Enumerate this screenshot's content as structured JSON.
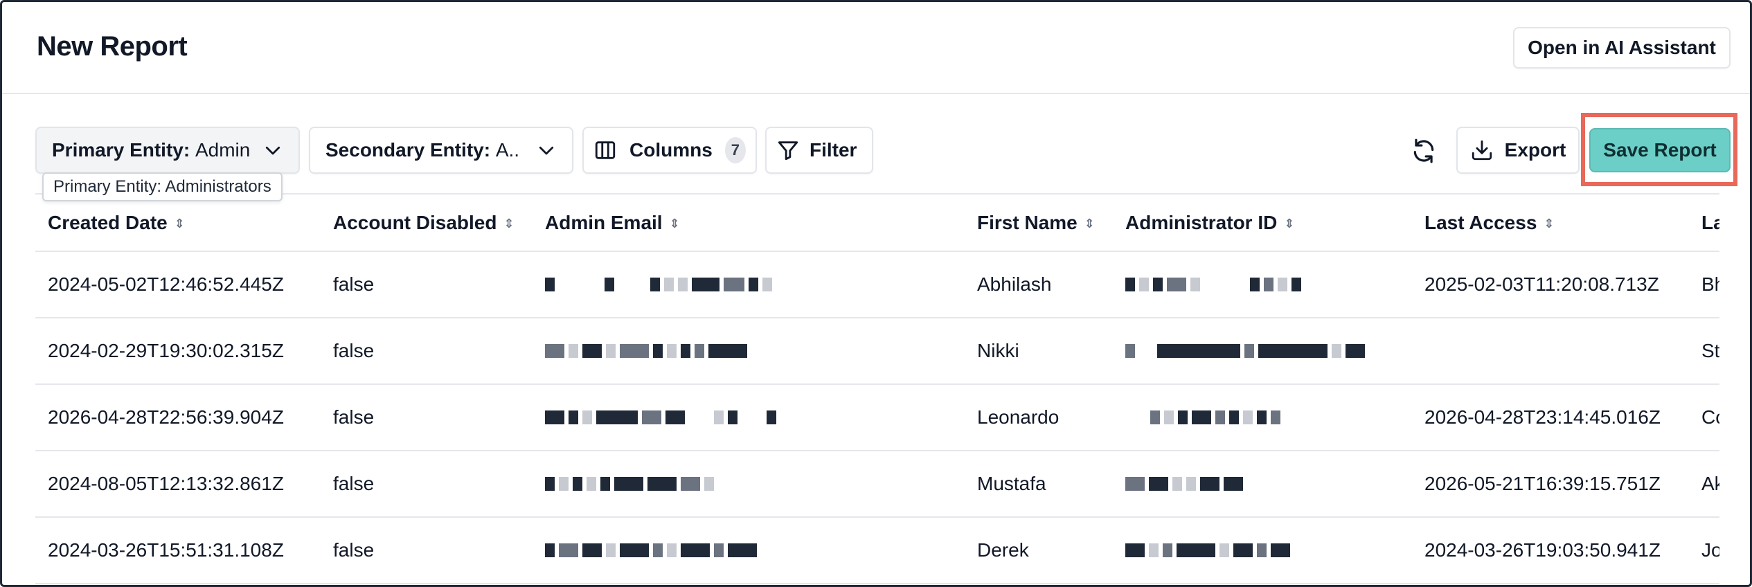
{
  "header": {
    "title": "New Report",
    "ai_button_label": "Open in AI Assistant"
  },
  "toolbar": {
    "primary_entity_label": "Primary Entity:",
    "primary_entity_value": "Admin",
    "secondary_entity_label": "Secondary Entity:",
    "secondary_entity_value": "A..",
    "columns_label": "Columns",
    "columns_count": "7",
    "filter_label": "Filter",
    "export_label": "Export",
    "save_label": "Save Report"
  },
  "tooltip": {
    "text": "Primary Entity: Administrators"
  },
  "table": {
    "columns": [
      "Created Date",
      "Account Disabled",
      "Admin Email",
      "First Name",
      "Administrator ID",
      "Last Access",
      "La"
    ],
    "rows": [
      {
        "created": "2024-05-02T12:46:52.445Z",
        "disabled": "false",
        "first": "Abhilash",
        "last_access": "2025-02-03T11:20:08.713Z",
        "last": "Bh"
      },
      {
        "created": "2024-02-29T19:30:02.315Z",
        "disabled": "false",
        "first": "Nikki",
        "last_access": "",
        "last": "St"
      },
      {
        "created": "2026-04-28T22:56:39.904Z",
        "disabled": "false",
        "first": "Leonardo",
        "last_access": "2026-04-28T23:14:45.016Z",
        "last": "Co"
      },
      {
        "created": "2024-08-05T12:13:32.861Z",
        "disabled": "false",
        "first": "Mustafa",
        "last_access": "2026-05-21T16:39:15.751Z",
        "last": "Ak"
      },
      {
        "created": "2024-03-26T15:51:31.108Z",
        "disabled": "false",
        "first": "Derek",
        "last_access": "2024-03-26T19:03:50.941Z",
        "last": "Jo"
      }
    ]
  },
  "colors": {
    "accent": "#6ccfc7",
    "highlight": "#e8685a"
  },
  "icons": [
    "chevron-down-icon",
    "columns-icon",
    "filter-icon",
    "refresh-icon",
    "download-icon",
    "sort-icon"
  ]
}
